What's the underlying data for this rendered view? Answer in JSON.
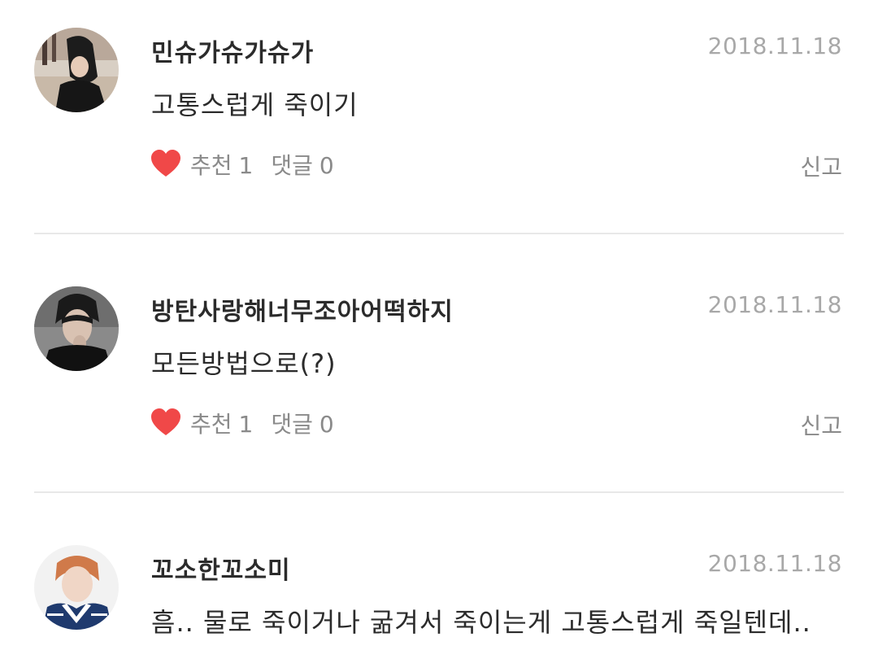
{
  "comments": [
    {
      "username": "민슈가슈가슈가",
      "date": "2018.11.18",
      "text": "고통스럽게 죽이기",
      "like_label": "추천",
      "like_count": "1",
      "reply_label": "댓글",
      "reply_count": "0",
      "report_label": "신고",
      "avatar_icon": "avatar-photo-person-black-hat"
    },
    {
      "username": "방탄사랑해너무조아어떡하지",
      "date": "2018.11.18",
      "text": "모든방법으로(?)",
      "like_label": "추천",
      "like_count": "1",
      "reply_label": "댓글",
      "reply_count": "0",
      "report_label": "신고",
      "avatar_icon": "avatar-photo-person-dark"
    },
    {
      "username": "꼬소한꼬소미",
      "date": "2018.11.18",
      "text": "흠.. 물로 죽이거나 굶겨서 죽이는게 고통스럽게 죽일텐데..",
      "avatar_icon": "avatar-photo-person-sailor-uniform"
    }
  ],
  "colors": {
    "heart": "#f04848",
    "username": "#2b2b2b",
    "date": "#a8a8a8",
    "meta": "#8a8a8a",
    "divider": "#e8e8e8"
  }
}
